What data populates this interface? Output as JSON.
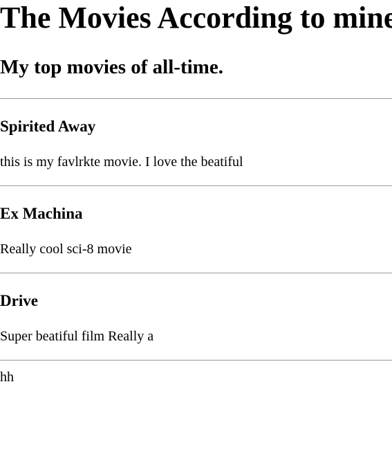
{
  "header": {
    "title": "The Movies According to mine",
    "subtitle": "My top movies of all-time."
  },
  "movies": [
    {
      "title": "Spirited Away",
      "description": "this is my favlrkte movie. I love the beatiful"
    },
    {
      "title": "Ex Machina",
      "description": "Really cool sci-8 movie"
    },
    {
      "title": "Drive",
      "description": "Super beatiful film Really a"
    }
  ],
  "footer": {
    "text": "hh"
  }
}
